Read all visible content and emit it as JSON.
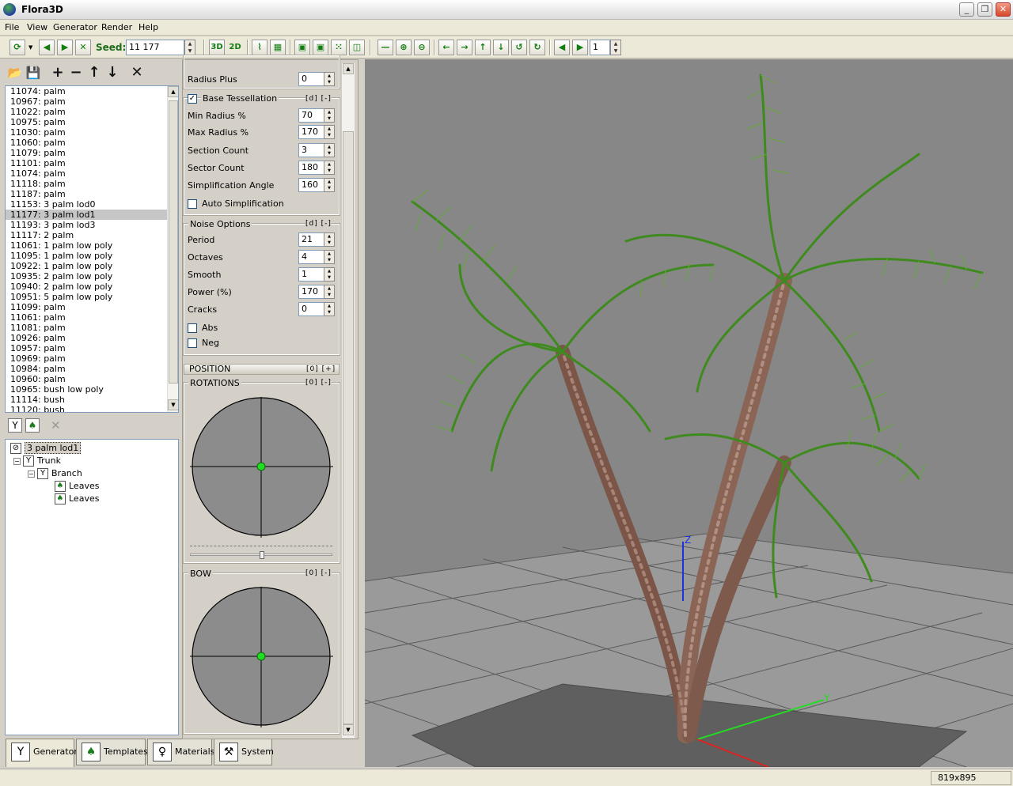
{
  "window": {
    "title": "Flora3D"
  },
  "menu": [
    "File",
    "View",
    "Generator",
    "Render",
    "Help"
  ],
  "toolbar": {
    "seed_label": "Seed:",
    "seed_value": "11 177",
    "btn_3d": "3D",
    "btn_2d": "2D",
    "frame_value": "1"
  },
  "presets": [
    "11074: palm",
    "10967: palm",
    "11022: palm",
    "10975: palm",
    "11030: palm",
    "11060: palm",
    "11079: palm",
    "11101: palm",
    "11074: palm",
    "11118: palm",
    "11187: palm",
    "11153: 3 palm lod0",
    "11177: 3 palm lod1",
    "11193: 3 palm lod3",
    "11117: 2 palm",
    "11061: 1 palm low poly",
    "11095: 1 palm low poly",
    "10922: 1 palm low poly",
    "10935: 2 palm low poly",
    "10940: 2 palm low poly",
    "10951: 5 palm low poly",
    "11099: palm",
    "11061: palm",
    "11081: palm",
    "10926: palm",
    "10957: palm",
    "10969: palm",
    "10984: palm",
    "10960: palm",
    "10965: bush low poly",
    "11114: bush",
    "11120: bush"
  ],
  "selected_preset_index": 12,
  "tree": {
    "root": "3 palm lod1",
    "trunk": "Trunk",
    "branch": "Branch",
    "leaves1": "Leaves",
    "leaves2": "Leaves"
  },
  "tabs": {
    "generator": "Generator",
    "templates": "Templates",
    "materials": "Materials",
    "system": "System"
  },
  "props": {
    "radius_plus_label": "Radius Plus",
    "radius_plus": "0",
    "base_tess_title": "Base Tessellation",
    "base_tess_ctl": "[d] [-]",
    "min_radius_label": "Min Radius %",
    "min_radius": "70",
    "max_radius_label": "Max Radius %",
    "max_radius": "170",
    "section_count_label": "Section Count",
    "section_count": "3",
    "sector_count_label": "Sector Count",
    "sector_count": "180",
    "simpl_angle_label": "Simplification Angle",
    "simpl_angle": "160",
    "auto_simpl_label": "Auto Simplification",
    "noise_title": "Noise Options",
    "noise_ctl": "[d] [-]",
    "period_label": "Period",
    "period": "21",
    "octaves_label": "Octaves",
    "octaves": "4",
    "smooth_label": "Smooth",
    "smooth": "1",
    "power_label": "Power (%)",
    "power": "170",
    "cracks_label": "Cracks",
    "cracks": "0",
    "abs_label": "Abs",
    "neg_label": "Neg",
    "position_title": "POSITION",
    "position_ctl": "[0] [+]",
    "rotations_title": "ROTATIONS",
    "rotations_ctl": "[0] [-]",
    "bow_title": "BOW",
    "bow_ctl": "[0] [-]"
  },
  "axes": {
    "z": "Z",
    "y": "Y"
  },
  "status": {
    "resolution": "819x895"
  },
  "colors": {
    "leaf": "#3f8a1f",
    "trunk": "#8a6455",
    "viewport": "#878787",
    "pad_dot": "#22dd22"
  }
}
